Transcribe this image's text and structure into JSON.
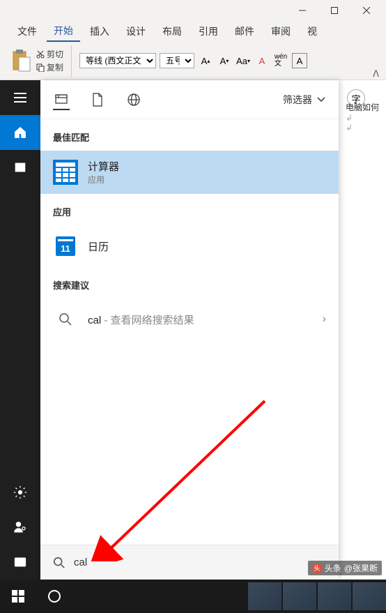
{
  "word": {
    "menu": {
      "file": "文件",
      "start": "开始",
      "insert": "插入",
      "design": "设计",
      "layout": "布局",
      "reference": "引用",
      "mail": "邮件",
      "review": "审阅",
      "view": "视"
    },
    "clipboard": {
      "cut": "剪切",
      "copy": "复制"
    },
    "font": {
      "name": "等线 (西文正文)",
      "size": "五号"
    },
    "style_btn": "字",
    "doc_text": "电脑如何"
  },
  "search": {
    "filter": "筛选器",
    "best_match": "最佳匹配",
    "apps_label": "应用",
    "suggestions_label": "搜索建议",
    "results": {
      "calculator": {
        "title": "计算器",
        "subtitle": "应用"
      },
      "calendar": {
        "title": "日历"
      },
      "web": {
        "query": "cal",
        "hint": " - 查看网络搜索结果"
      }
    },
    "input": "cal"
  },
  "watermark": {
    "prefix": "头条",
    "author": "@张果断"
  }
}
